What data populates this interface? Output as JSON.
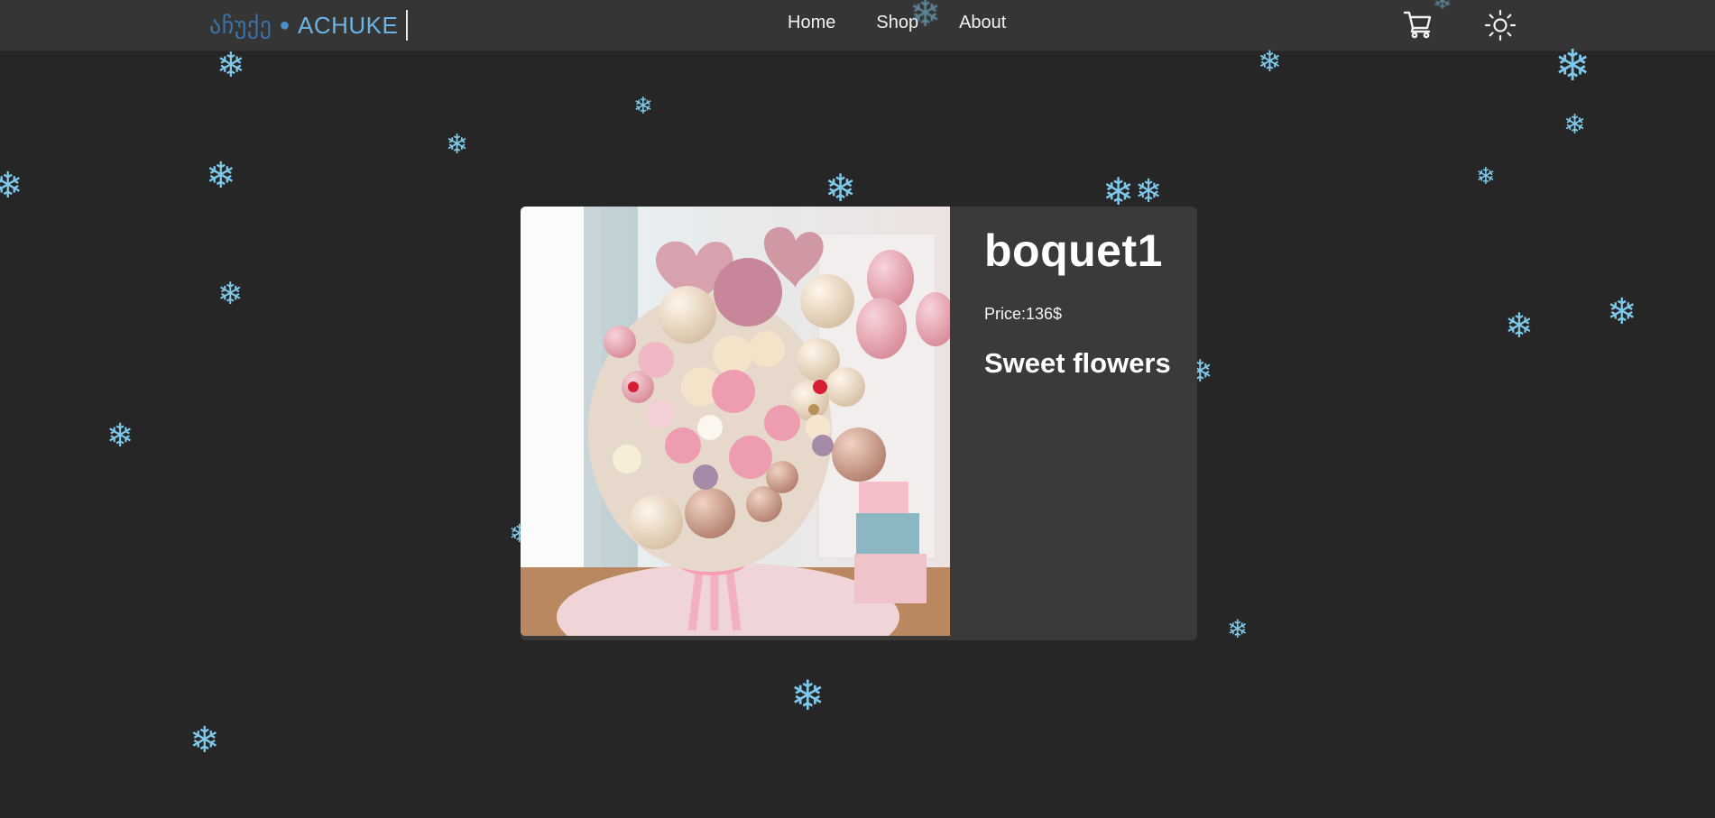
{
  "brand": {
    "geo_text": "აჩუქე",
    "separator": "●",
    "latin_text": "ACHUKE"
  },
  "nav": {
    "items": [
      "Home",
      "Shop",
      "About"
    ]
  },
  "icons": {
    "cart": "cart-icon",
    "theme": "sun-icon",
    "decor": "snowflake-icon"
  },
  "colors": {
    "background": "#262626",
    "navbar": "#353535",
    "card": "#3a3a3a",
    "snow": "#7ec8ea",
    "brand_dark": "#3a73a8",
    "brand_light": "#6cb4e4"
  },
  "product": {
    "name": "boquet1",
    "price_label": "Price:",
    "price_value": "136$",
    "description": "Sweet flowers",
    "image": "flower-balloon-bouquet-photo"
  }
}
